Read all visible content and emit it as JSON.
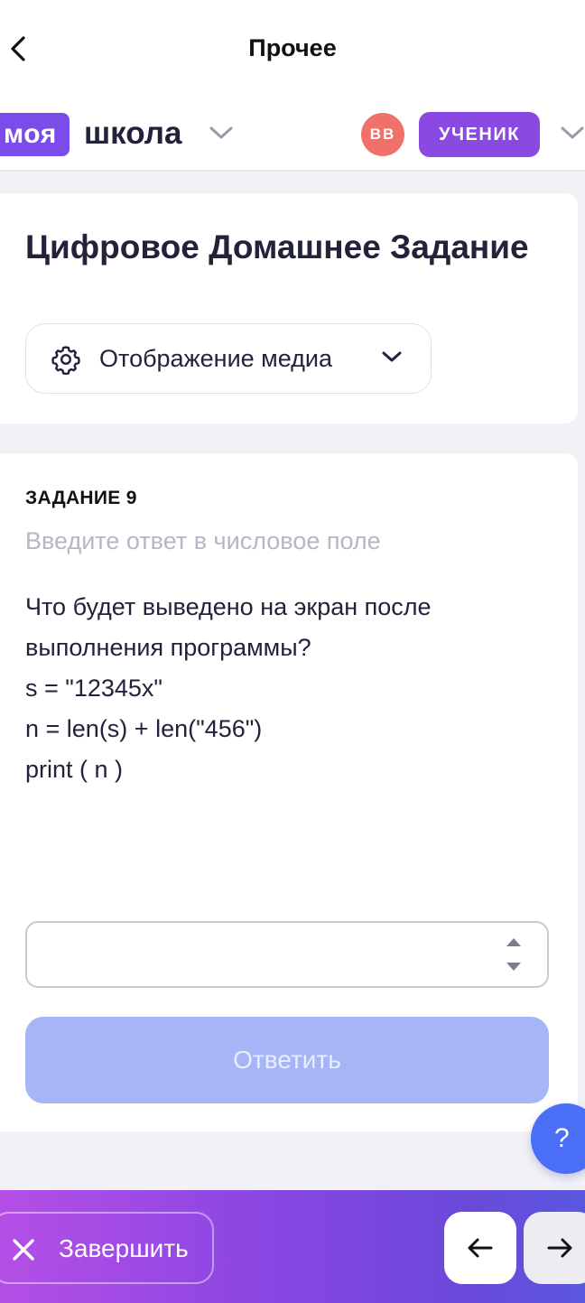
{
  "topbar": {
    "title": "Прочее",
    "back_icon": "chevron-left-icon"
  },
  "header": {
    "logo_part1": "моя",
    "logo_part2": "школа",
    "avatar_initials": "ВВ",
    "role": "УЧЕНИК",
    "colors": {
      "logo": "#7a4dea",
      "avatar": "#f0706a",
      "role": "#8a49e0"
    }
  },
  "homework": {
    "title": "Цифровое Домашнее Задание",
    "media_select": {
      "label": "Отображение медиа",
      "icon": "gear-icon"
    }
  },
  "task": {
    "label": "ЗАДАНИЕ 9",
    "hint": "Введите ответ в числовое поле",
    "lines": [
      "Что будет выведено на экран после",
      "выполнения программы?",
      "s = \"12345x\"",
      "n = len(s) + len(\"456\")",
      "print ( n )"
    ],
    "answer_value": "",
    "submit_label": "Ответить",
    "submit_color": "#a5b5f6"
  },
  "help": {
    "label": "?"
  },
  "bottom": {
    "finish_label": "Завершить",
    "prev_icon": "arrow-left-icon",
    "next_icon": "arrow-right-icon"
  }
}
